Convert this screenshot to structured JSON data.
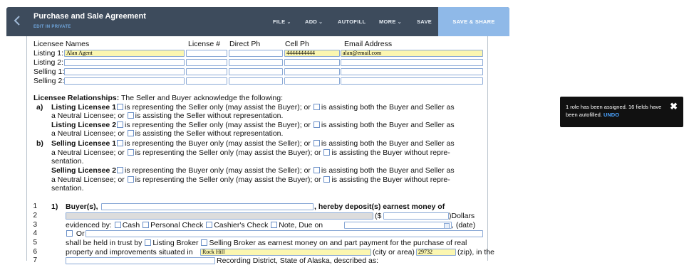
{
  "header": {
    "back_icon": "chevron-left-icon",
    "title": "Purchase and Sale Agreement",
    "subtitle": "EDIT IN PRIVATE",
    "menus": {
      "file": "FILE",
      "add": "ADD",
      "autofill": "AUTOFILL",
      "more": "MORE",
      "save": "SAVE",
      "save_share": "SAVE & SHARE"
    },
    "accent": "#8fb9e8",
    "bar_color": "#3d4b5c"
  },
  "licensee_table": {
    "headers": {
      "names": "Licensee Names",
      "license": "License #",
      "direct": "Direct Ph",
      "cell": "Cell Ph",
      "email": "Email Address"
    },
    "rows": [
      {
        "label": "Listing 1:",
        "name": "Alan Agent",
        "license": "",
        "direct": "",
        "cell": "4444444444",
        "email": "alan@email.com"
      },
      {
        "label": "Listing 2:",
        "name": "",
        "license": "",
        "direct": "",
        "cell": "",
        "email": ""
      },
      {
        "label": "Selling 1:",
        "name": "",
        "license": "",
        "direct": "",
        "cell": "",
        "email": ""
      },
      {
        "label": "Selling 2:",
        "name": "",
        "license": "",
        "direct": "",
        "cell": "",
        "email": ""
      }
    ]
  },
  "relationships": {
    "heading": "Licensee Relationships:",
    "intro": "The Seller and Buyer acknowledge the following:",
    "a_label": "a)",
    "b_label": "b)",
    "l1_title": "Listing Licensee 1",
    "l1_t1": "is representing the Seller only (may assist the Buyer); or",
    "l1_t2": "is assisting both the Buyer and Seller as",
    "l1_t3": "a Neutral Licensee; or",
    "l1_t4": "is assisting the Seller without representation.",
    "l2_title": "Listing Licensee 2",
    "l2_t1": "is representing the Seller only (may assist the Buyer); or",
    "l2_t2": "is assisting both the Buyer and Seller as",
    "l2_t3": "a Neutral Licensee; or",
    "l2_t4": "is assisting the Seller without representation.",
    "s1_title": "Selling Licensee 1",
    "s1_t1": "is representing the Buyer only (may assist the Seller); or",
    "s1_t2": "is assisting both the Buyer and Seller as",
    "s1_t3": "a Neutral Licensee; or",
    "s1_t4": "is representing the Seller only (may assist the Buyer); or",
    "s1_t5": "is assisting the Buyer without repre-",
    "s1_t6": "sentation.",
    "s2_title": "Selling Licensee 2",
    "s2_t1": "is representing the Buyer only (may assist the Seller); or",
    "s2_t2": "is assisting both the Buyer and Seller as",
    "s2_t3": "a Neutral Licensee; or",
    "s2_t4": "is representing the Seller only (may assist the Buyer); or",
    "s2_t5": "is assisting the Buyer without repre-",
    "s2_t6": "sentation."
  },
  "section1": {
    "line_numbers": [
      "1",
      "2",
      "3",
      "4",
      "5",
      "6",
      "7"
    ],
    "num": "1)",
    "buyers": "Buyer(s),",
    "deposit": ", hereby deposit(s) earnest money of",
    "paren_dollar": "($",
    "dollars": ")Dollars",
    "evidenced": "evidenced by:",
    "cash": "Cash",
    "personal_check": "Personal Check",
    "cashiers_check": "Cashier's Check",
    "note_due": "Note, Due on",
    "date": ", (date)",
    "or": "Or",
    "held_in_trust": "shall be held in trust by",
    "listing_broker": "Listing Broker",
    "selling_broker": "Selling Broker as earnest money on and part payment for the purchase of real",
    "property_text": "property and improvements situated in",
    "city_value": "Rock Hill",
    "city_or_area": "(city or area)",
    "zip_value": "29732",
    "zip_text": "(zip), in the",
    "recording": "Recording District, State of Alaska, described as:"
  },
  "toast": {
    "message": "1 role has been assigned. 16 fields have been autofilled.",
    "undo": "UNDO",
    "close_icon": "close-icon"
  }
}
